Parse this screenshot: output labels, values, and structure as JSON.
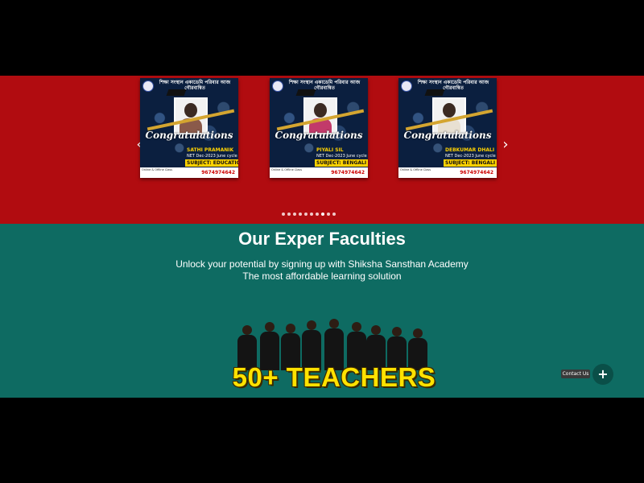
{
  "carousel": {
    "prev_icon": "chevron-left-icon",
    "next_icon": "chevron-right-icon",
    "prev_glyph": "‹",
    "next_glyph": "›",
    "cards": [
      {
        "header": "শিক্ষা সংস্থান একাডেমি পরিবার আজ গৌরবান্বিত",
        "congrats": "Congratulations",
        "name": "SATHI PRAMANIK",
        "exam": "NET Dec-2023 June cycle",
        "subject": "SUBJECT: EDUCATION",
        "footer_text": "Online & Offline Class",
        "phone": "9674974642"
      },
      {
        "header": "শিক্ষা সংস্থান একাডেমি পরিবার আজ গৌরবান্বিত",
        "congrats": "Congratulations",
        "name": "PIYALI SIL",
        "exam": "NET Dec-2023 June cycle",
        "subject": "SUBJECT: BENGALI",
        "footer_text": "Online & Offline Class",
        "phone": "9674974642"
      },
      {
        "header": "শিক্ষা সংস্থান একাডেমি পরিবার আজ গৌরবান্বিত",
        "congrats": "Congratulations",
        "name": "DEBKUMAR DHALI",
        "exam": "NET Dec-2023 June cycle",
        "subject": "SUBJECT: BENGALI",
        "footer_text": "Online & Offline Class",
        "phone": "9674974642"
      }
    ],
    "dot_count": 10,
    "active_dot": 7
  },
  "faculties": {
    "title": "Our Exper Faculties",
    "subtitle_line1": "Unlock your potential by signing up with Shiksha Sansthan Academy",
    "subtitle_line2": "The most affordable learning solution",
    "banner_text": "50+ TEACHERS"
  },
  "contact": {
    "label": "Contact Us",
    "fab_icon": "plus-icon",
    "fab_glyph": "+"
  },
  "colors": {
    "red_band": "#b10c10",
    "green_band": "#0e6b62",
    "banner_yellow": "#ffe200"
  }
}
